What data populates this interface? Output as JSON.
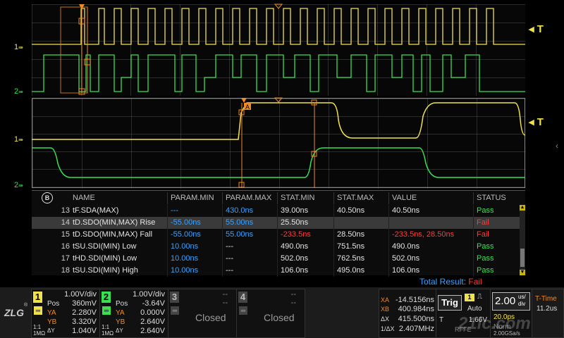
{
  "colors": {
    "ch1": "#f2e24a",
    "ch2": "#39e052",
    "blue": "#3aa3ff",
    "red": "#ff3b3b",
    "orange": "#f08a24"
  },
  "waveform": {
    "ch1_marker": "1",
    "ch2_marker": "2",
    "trigger_label": "T"
  },
  "table": {
    "headers": [
      "NAME",
      "PARAM.MIN",
      "PARAM.MAX",
      "STAT.MIN",
      "STAT.MAX",
      "VALUE",
      "STATUS"
    ],
    "rows": [
      {
        "idx": "13",
        "name": "tF.SDA(MAX)",
        "pmin": "---",
        "pmax": "430.0ns",
        "smin": "39.00ns",
        "smax": "40.50ns",
        "value": "40.50ns",
        "status": "Pass"
      },
      {
        "idx": "14",
        "name": "tD.SDO(MIN,MAX) Rise",
        "pmin": "-55.00ns",
        "pmax": "55.00ns",
        "smin": "25.50ns",
        "smax": "",
        "value": "",
        "status": "Fail"
      },
      {
        "idx": "15",
        "name": "tD.SDO(MIN,MAX) Fall",
        "pmin": "-55.00ns",
        "pmax": "55.00ns",
        "smin": "-233.5ns",
        "smax": "28.50ns",
        "value": "-233.5ns, 28.50ns",
        "status": "Fail"
      },
      {
        "idx": "16",
        "name": "tSU.SDI(MIN) Low",
        "pmin": "10.00ns",
        "pmax": "---",
        "smin": "490.0ns",
        "smax": "751.5ns",
        "value": "490.0ns",
        "status": "Pass"
      },
      {
        "idx": "17",
        "name": "tHD.SDI(MIN) Low",
        "pmin": "10.00ns",
        "pmax": "---",
        "smin": "502.0ns",
        "smax": "762.5ns",
        "value": "502.0ns",
        "status": "Pass"
      },
      {
        "idx": "18",
        "name": "tSU.SDI(MIN) High",
        "pmin": "10.00ns",
        "pmax": "---",
        "smin": "106.0ns",
        "smax": "495.0ns",
        "value": "106.0ns",
        "status": "Pass"
      }
    ],
    "total_label": "Total Result:",
    "total_value": "Fail"
  },
  "ch1": {
    "num": "1",
    "vdiv": "1.00V/div",
    "pos_label": "Pos",
    "pos": "360mV",
    "ya_label": "YA",
    "ya": "2.280V",
    "yb_label": "YB",
    "yb": "3.320V",
    "dy_label": "ΔY",
    "dy": "1.040V",
    "coupling": "1:1",
    "imp": "1MΩ"
  },
  "ch2": {
    "num": "2",
    "vdiv": "1.00V/div",
    "pos_label": "Pos",
    "pos": "-3.64V",
    "ya_label": "YA",
    "ya": "0.000V",
    "yb_label": "YB",
    "yb": "2.640V",
    "dy_label": "ΔY",
    "dy": "2.640V",
    "coupling": "1:1",
    "imp": "1MΩ"
  },
  "ch3": {
    "num": "3",
    "dash1": "--",
    "dash2": "--",
    "status": "Closed"
  },
  "ch4": {
    "num": "4",
    "dash1": "--",
    "dash2": "--",
    "status": "Closed"
  },
  "cursor": {
    "xa_label": "XA",
    "xa": "-14.5156ns",
    "xb_label": "XB",
    "xb": "400.984ns",
    "dx_label": "ΔX",
    "dx": "415.500ns",
    "inv_label": "1/ΔX",
    "inv": "2.407MHz"
  },
  "trigger": {
    "title": "Trig",
    "source": "1",
    "mode": "Auto",
    "type": "T",
    "level": "1.66V",
    "coupling": "RFFE"
  },
  "timebase": {
    "value": "2.00",
    "unit_top": "us/",
    "unit_bot": "div",
    "delay": "20.0ps",
    "mode": "Norm",
    "rate": "2.00GSa/s"
  },
  "time_mode": {
    "title": "T-Time",
    "value": "11.2us"
  },
  "watermark": "21ic.com",
  "logo": "ZLG"
}
